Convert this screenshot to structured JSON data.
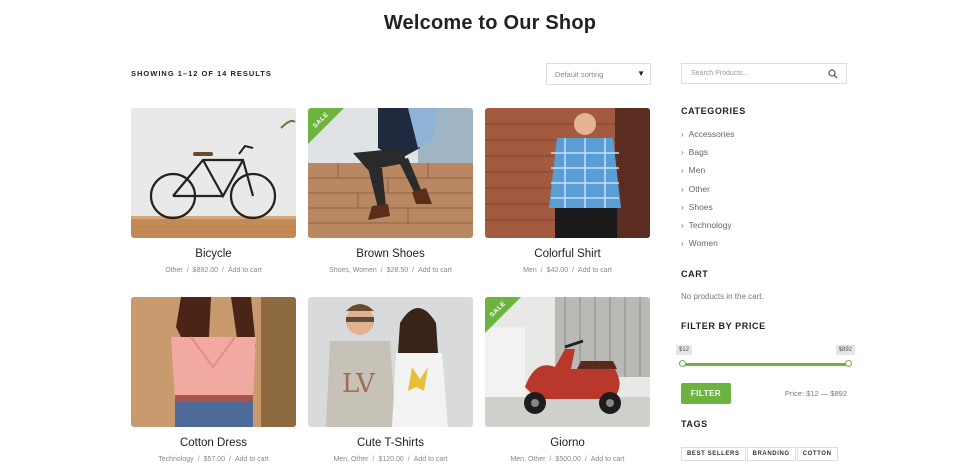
{
  "page": {
    "title": "Welcome to Our Shop"
  },
  "toolbar": {
    "result_count": "SHOWING 1–12 OF 14 RESULTS",
    "sort_value": "Default sorting"
  },
  "products": [
    {
      "name": "Bicycle",
      "categories": "Other",
      "price": "$892.00",
      "action": "Add to cart",
      "sale": false
    },
    {
      "name": "Brown Shoes",
      "categories": "Shoes, Women",
      "price": "$28.50",
      "action": "Add to cart",
      "sale": true,
      "sale_label": "SALE"
    },
    {
      "name": "Colorful Shirt",
      "categories": "Men",
      "price": "$42.00",
      "action": "Add to cart",
      "sale": false
    },
    {
      "name": "Cotton Dress",
      "categories": "Technology",
      "price": "$57.00",
      "action": "Add to cart",
      "sale": false
    },
    {
      "name": "Cute T-Shirts",
      "categories": "Men, Other",
      "price": "$120.00",
      "action": "Add to cart",
      "sale": false
    },
    {
      "name": "Giorno",
      "categories": "Men, Other",
      "price": "$500.00",
      "action": "Add to cart",
      "sale": true,
      "sale_label": "SALE"
    }
  ],
  "sidebar": {
    "search_placeholder": "Search Products...",
    "categories_title": "CATEGORIES",
    "categories": [
      "Accessories",
      "Bags",
      "Men",
      "Other",
      "Shoes",
      "Technology",
      "Women"
    ],
    "cart_title": "CART",
    "cart_empty": "No products in the cart.",
    "price_title": "FILTER BY PRICE",
    "price_min_label": "$12",
    "price_max_label": "$892",
    "filter_label": "FILTER",
    "price_range": "Price: $12 — $892",
    "tags_title": "TAGS",
    "tags": [
      "BEST SELLERS",
      "BRANDING",
      "COTTON"
    ]
  },
  "colors": {
    "accent": "#6cb33f"
  }
}
